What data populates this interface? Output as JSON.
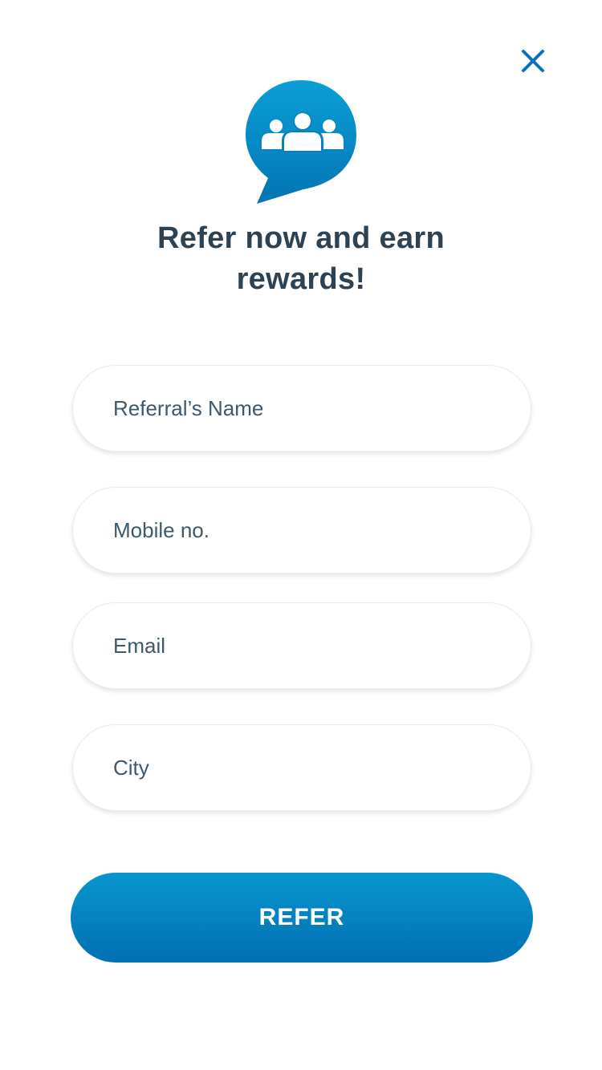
{
  "header": {
    "close_icon": "close-icon",
    "close_color": "#0a73b3"
  },
  "logo": {
    "icon": "group-chat-bubble-icon",
    "gradient_top": "#0a9fd6",
    "gradient_bottom": "#0474b4"
  },
  "title": {
    "line1": "Refer now and earn",
    "line2": "rewards!"
  },
  "form": {
    "fields": [
      {
        "placeholder": "Referral’s Name",
        "value": ""
      },
      {
        "placeholder": "Mobile no.",
        "value": ""
      },
      {
        "placeholder": "Email",
        "value": ""
      },
      {
        "placeholder": "City",
        "value": ""
      }
    ]
  },
  "actions": {
    "refer_label": "REFER",
    "refer_color_top": "#0895cd",
    "refer_color_bottom": "#0270b2"
  }
}
